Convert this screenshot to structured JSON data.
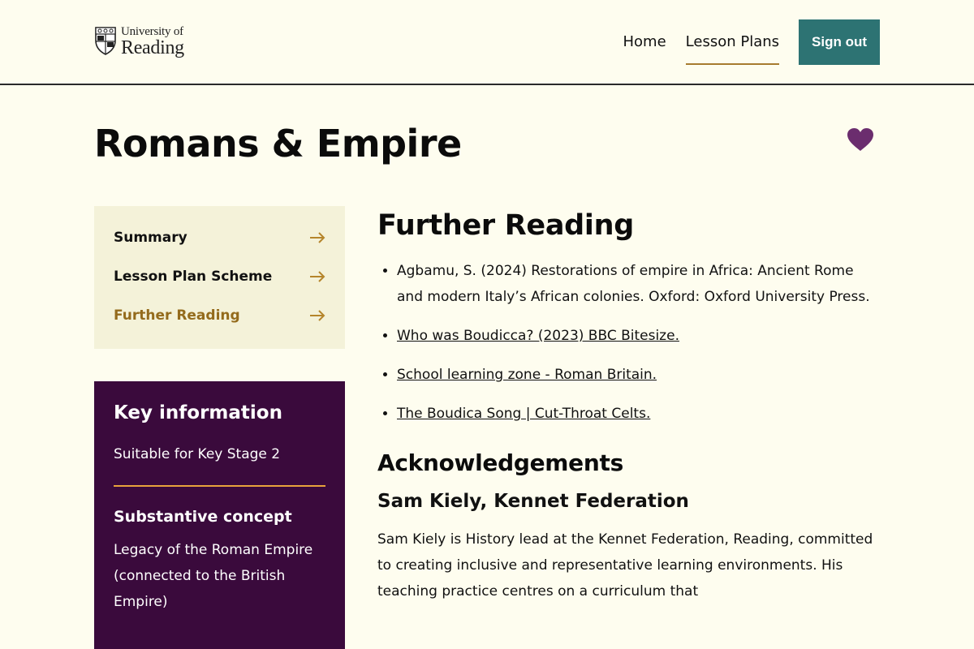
{
  "header": {
    "logo_line1": "University of",
    "logo_line2": "Reading",
    "nav": {
      "home": "Home",
      "lesson_plans": "Lesson Plans"
    },
    "sign_out": "Sign out"
  },
  "page_title": "Romans & Empire",
  "toc": {
    "items": [
      {
        "label": "Summary"
      },
      {
        "label": "Lesson Plan Scheme"
      },
      {
        "label": "Further Reading"
      }
    ]
  },
  "key_info": {
    "title": "Key information",
    "suitable": "Suitable for Key Stage 2",
    "concept_heading": "Substantive concept",
    "concept": "Legacy of the Roman Empire (connected to the British Empire)"
  },
  "further_reading": {
    "title": "Further Reading",
    "items": [
      "Agbamu, S. (2024) Restorations of empire in Africa: Ancient Rome and modern Italy’s African colonies. Oxford: Oxford University Press.",
      "Who was Boudicca? (2023) BBC Bitesize.",
      "School learning zone - Roman Britain.",
      "The Boudica Song | Cut-Throat Celts."
    ]
  },
  "acknowledgements": {
    "title": "Acknowledgements",
    "person": "Sam Kiely, Kennet Federation",
    "bio": "Sam Kiely is History lead at the Kennet Federation, Reading, committed to creating inclusive and representative learning environments. His teaching practice centres on a curriculum that"
  },
  "colors": {
    "accent_teal": "#2d7373",
    "accent_gold": "#946b1c",
    "purple": "#3a0a3c",
    "heart": "#6b2d6e"
  }
}
